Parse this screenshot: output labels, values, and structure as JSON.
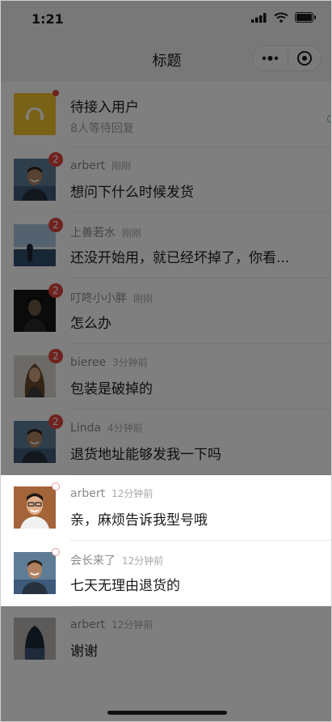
{
  "status_bar": {
    "time": "1:21"
  },
  "nav": {
    "title": "标题"
  },
  "queue": {
    "title": "待接入用户",
    "subtitle": "8人等待回复"
  },
  "conversations": [
    {
      "name": "arbert",
      "time": "刚刚",
      "message": "想问下什么时候发货",
      "badge": "2",
      "avatar": "man-smiling-photo"
    },
    {
      "name": "上善若水",
      "time": "刚刚",
      "message": "还没开始用，就已经坏掉了，你看...",
      "badge": "2",
      "avatar": "beach-silhouette-photo"
    },
    {
      "name": "叮咚小小胖",
      "time": "刚刚",
      "message": "怎么办",
      "badge": "2",
      "avatar": "dark-portrait-photo"
    },
    {
      "name": "bieree",
      "time": "3分钟前",
      "message": "包装是破掉的",
      "badge": "2",
      "avatar": "woman-portrait-photo"
    },
    {
      "name": "Linda",
      "time": "4分钟前",
      "message": "退货地址能够发我一下吗",
      "badge": "2",
      "avatar": "man-smiling-photo"
    },
    {
      "name": "arbert",
      "time": "12分钟前",
      "message": "亲，麻烦告诉我型号哦",
      "badge": "",
      "avatar": "man-glasses-photo"
    },
    {
      "name": "会长来了",
      "time": "12分钟前",
      "message": "七天无理由退货的",
      "badge": "",
      "avatar": "man-smiling-photo"
    },
    {
      "name": "arbert",
      "time": "12分钟前",
      "message": "谢谢",
      "badge": "",
      "avatar": "woman-back-photo"
    }
  ],
  "colors": {
    "badge": "#e0453e",
    "queue_icon_bg": "#f2c22b",
    "overlay": "rgba(0,0,0,0.5)"
  }
}
